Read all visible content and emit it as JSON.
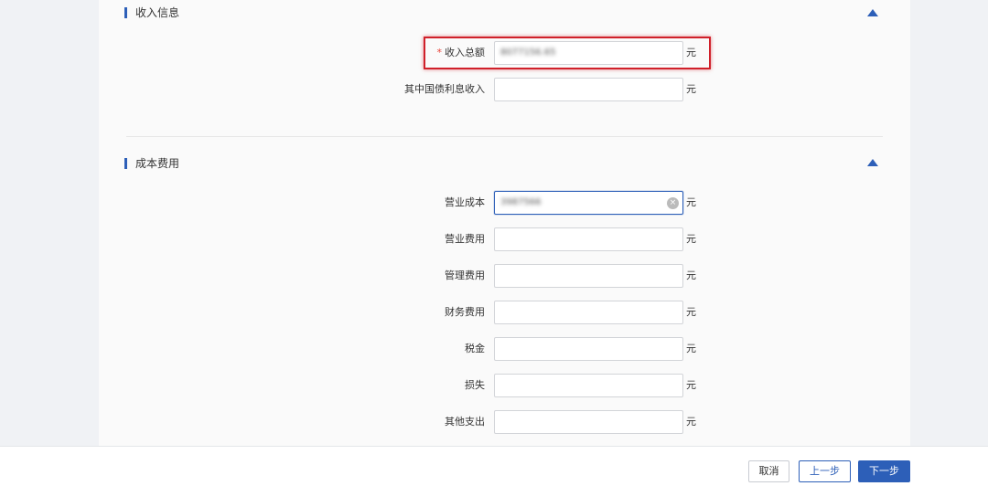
{
  "income_section": {
    "title": "收入信息",
    "fields": [
      {
        "label": "收入总额",
        "required": true,
        "value": "8077156.65",
        "unit": "元"
      },
      {
        "label": "其中国债利息收入",
        "required": false,
        "value": "",
        "unit": "元"
      }
    ]
  },
  "cost_section": {
    "title": "成本费用",
    "fields": [
      {
        "label": "营业成本",
        "value": "3987566",
        "unit": "元"
      },
      {
        "label": "营业费用",
        "value": "",
        "unit": "元"
      },
      {
        "label": "管理费用",
        "value": "",
        "unit": "元"
      },
      {
        "label": "财务费用",
        "value": "",
        "unit": "元"
      },
      {
        "label": "税金",
        "value": "",
        "unit": "元"
      },
      {
        "label": "损失",
        "value": "",
        "unit": "元"
      },
      {
        "label": "其他支出",
        "value": "",
        "unit": "元"
      }
    ]
  },
  "required_mark": "*",
  "clear_icon_glyph": "×",
  "footer": {
    "cancel_label": "取消",
    "prev_label": "上一步",
    "next_label": "下一步"
  },
  "colors": {
    "accent": "#2d5fb8",
    "highlight": "#d0202a",
    "required": "#e8433a"
  }
}
